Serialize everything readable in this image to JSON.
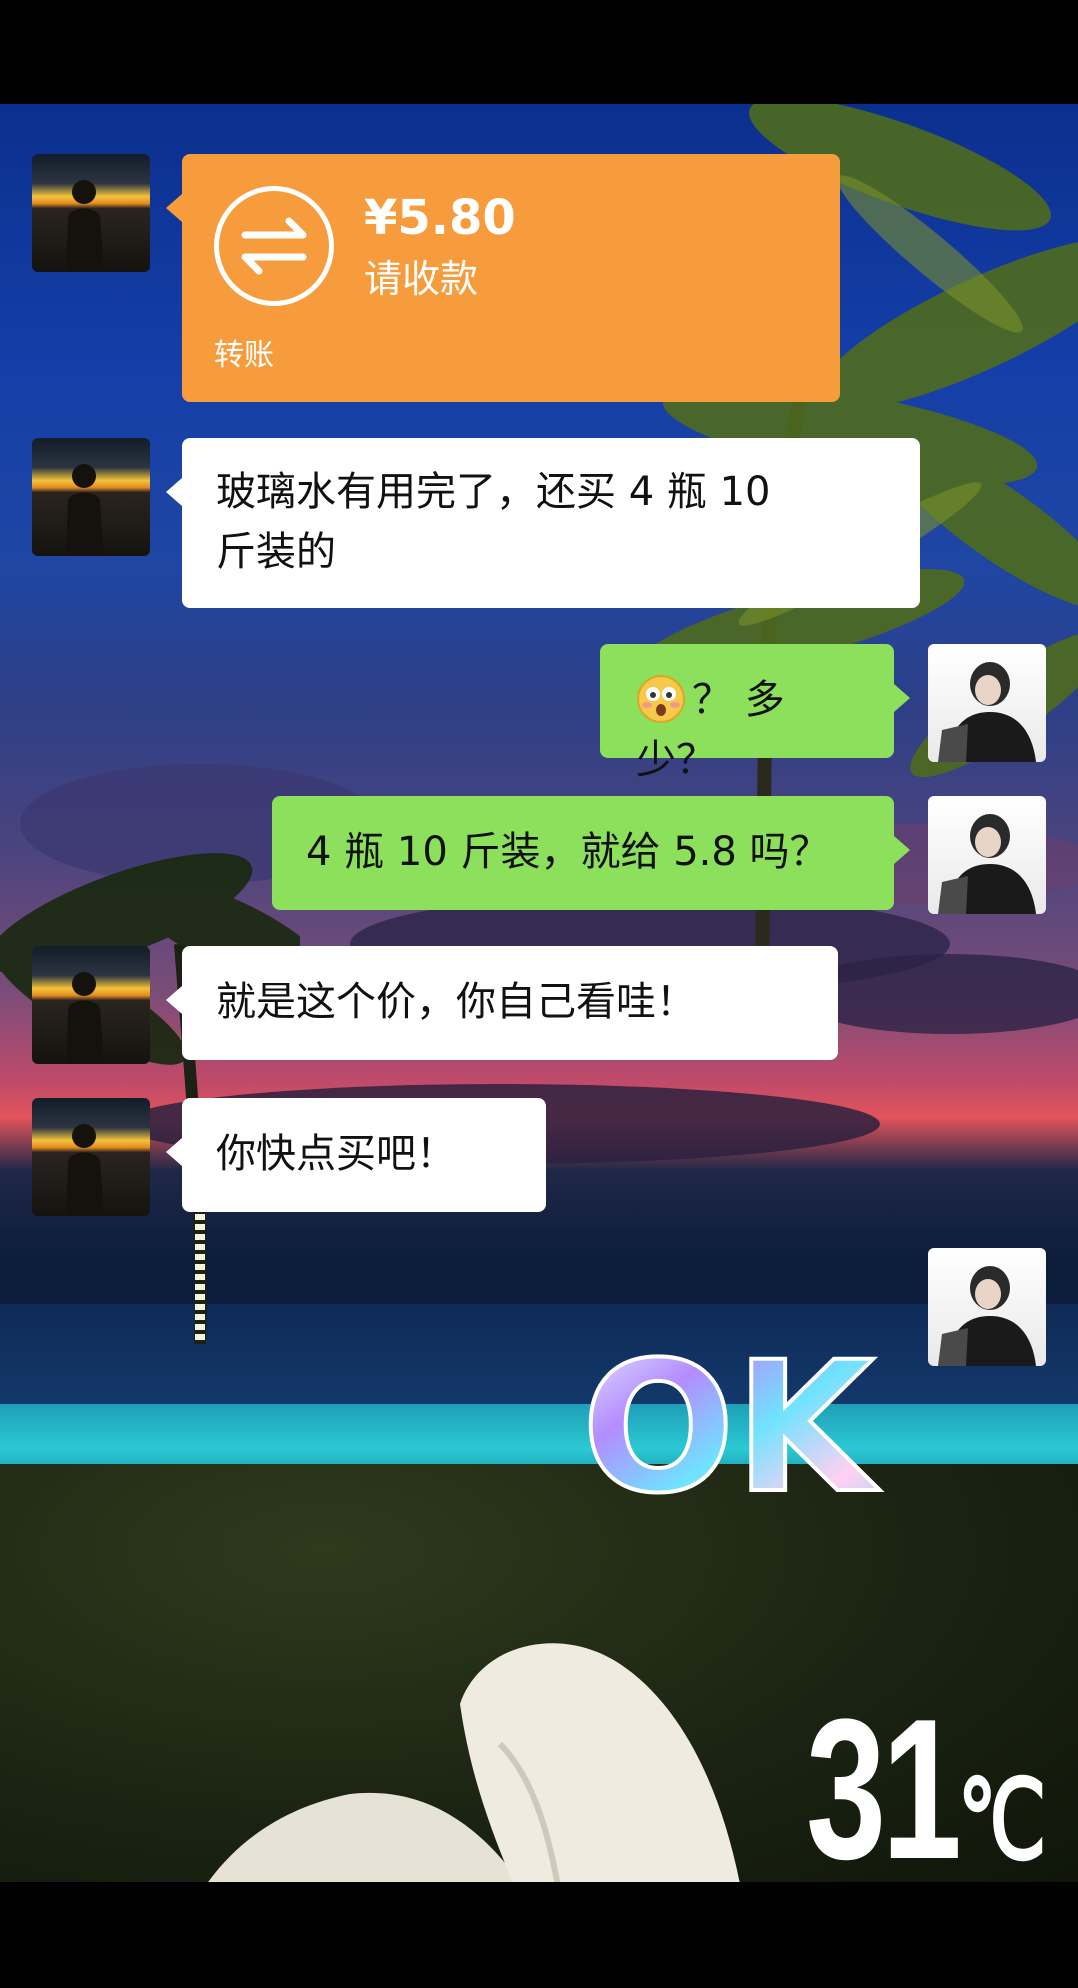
{
  "chat": {
    "transfer": {
      "amount": "¥5.80",
      "status": "请收款",
      "label": "转账"
    },
    "messages": [
      {
        "text_line1": "玻璃水有用完了，还买 4 瓶 10",
        "text_line2": "斤装的"
      },
      {
        "text": "？ 多少？",
        "emoji": "flushed-face"
      },
      {
        "text": "4 瓶 10 斤装，就给 5.8 吗？"
      },
      {
        "text": "就是这个价，你自己看哇！"
      },
      {
        "text": "你快点买吧！"
      }
    ],
    "sticker": {
      "text": "OK"
    }
  },
  "overlay": {
    "temperature": "31",
    "unit": "℃"
  },
  "colors": {
    "transfer": "#f79c3d",
    "sent_bubble": "#8ce05c",
    "received_bubble": "#ffffff"
  }
}
